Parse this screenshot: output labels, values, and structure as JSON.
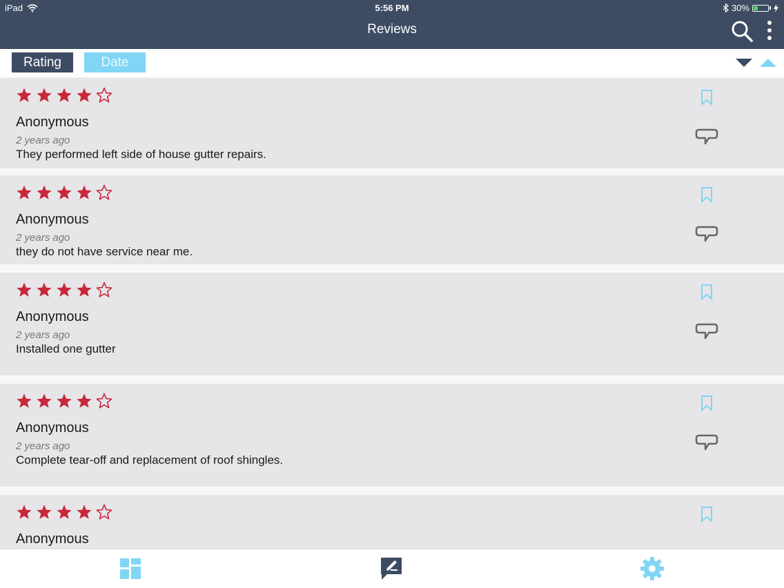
{
  "status": {
    "device": "iPad",
    "time": "5:56 PM",
    "battery": "30%",
    "battery_fraction": 0.3
  },
  "nav": {
    "title": "Reviews"
  },
  "sort": {
    "rating_label": "Rating",
    "date_label": "Date"
  },
  "colors": {
    "header": "#3d4b63",
    "accent": "#80d6f4",
    "star": "#c8283a",
    "card": "#e6e5e8"
  },
  "reviews": [
    {
      "rating": 4,
      "author": "Anonymous",
      "ago": "2 years ago",
      "text": "They performed left side of house gutter repairs."
    },
    {
      "rating": 4,
      "author": "Anonymous",
      "ago": "2 years ago",
      "text": "they do not have service near me."
    },
    {
      "rating": 4,
      "author": "Anonymous",
      "ago": "2 years ago",
      "text": "Installed one gutter"
    },
    {
      "rating": 4,
      "author": "Anonymous",
      "ago": "2 years ago",
      "text": "Complete tear-off and replacement of roof shingles."
    },
    {
      "rating": 4,
      "author": "Anonymous",
      "ago": "",
      "text": ""
    }
  ],
  "icons": {
    "search": "search-icon",
    "more": "more-vertical-icon",
    "sort_desc": "caret-down-icon",
    "sort_asc": "caret-up-icon",
    "bookmark": "bookmark-icon",
    "comment": "comment-icon",
    "dashboard": "dashboard-icon",
    "reviews": "write-review-icon",
    "settings": "gear-icon"
  }
}
